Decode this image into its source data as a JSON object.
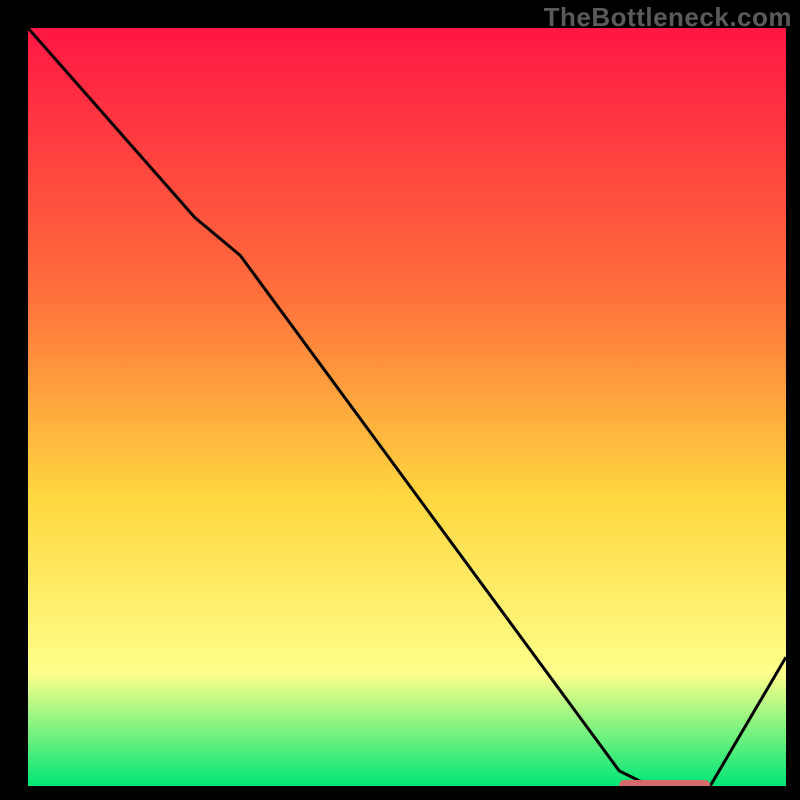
{
  "watermark": "TheBottleneck.com",
  "colors": {
    "gradient_top": "#ff1744",
    "gradient_mid1": "#ff6f3b",
    "gradient_mid2": "#ffd740",
    "gradient_mid3": "#ffff8a",
    "gradient_bottom": "#00e676",
    "curve": "#000000",
    "marker": "#d46a6a",
    "frame": "#000000"
  },
  "chart_data": {
    "type": "line",
    "title": "",
    "xlabel": "",
    "ylabel": "",
    "xlim": [
      0,
      100
    ],
    "ylim": [
      0,
      100
    ],
    "x": [
      0,
      22,
      28,
      78,
      82,
      90,
      100
    ],
    "values": [
      100,
      75,
      70,
      2,
      0,
      0,
      17
    ],
    "optimum_marker": {
      "x_start": 78,
      "x_end": 90,
      "y": 0
    }
  }
}
